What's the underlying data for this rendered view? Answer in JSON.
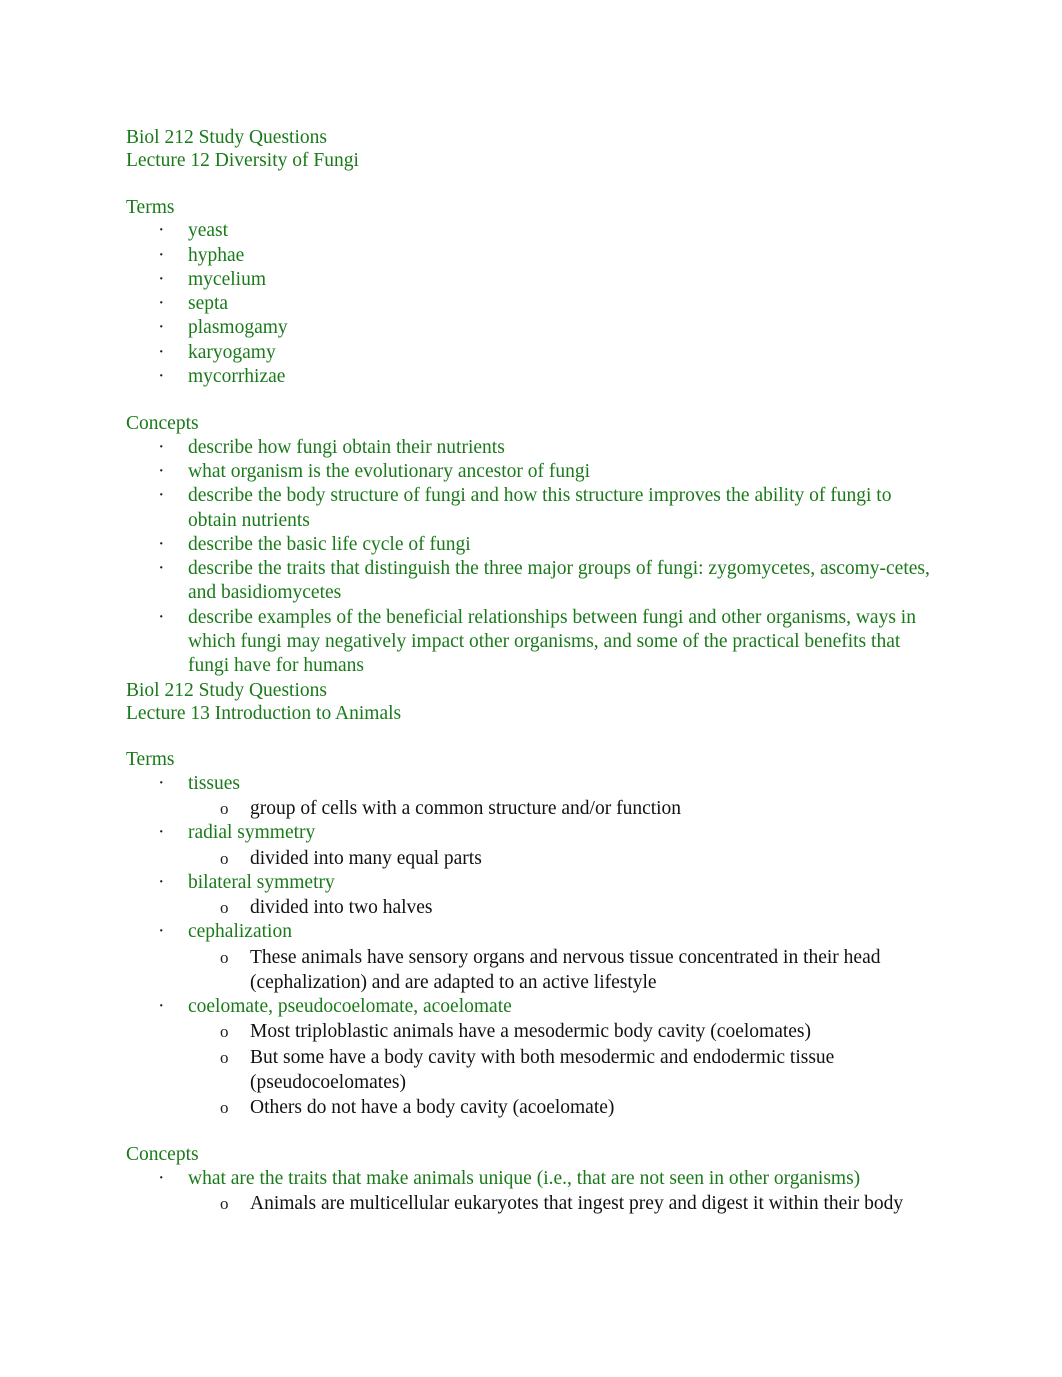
{
  "document": {
    "page_color": "#ffffff",
    "heading_color": "#1a7a1a",
    "body_color": "#111111",
    "bullet_marker_level1": "·",
    "bullet_marker_level2": "o"
  },
  "sections": [
    {
      "title_line1": "Biol 212 Study Questions",
      "title_line2": "Lecture 12 Diversity of Fungi",
      "terms_heading": "Terms",
      "terms": [
        {
          "text": "yeast"
        },
        {
          "text": "hyphae"
        },
        {
          "text": "mycelium"
        },
        {
          "text": "septa"
        },
        {
          "text": "plasmogamy"
        },
        {
          "text": "karyogamy"
        },
        {
          "text": "mycorrhizae"
        }
      ],
      "concepts_heading": "Concepts",
      "concepts": [
        {
          "text": "describe how fungi obtain their nutrients"
        },
        {
          "text": "what organism is the evolutionary ancestor of fungi"
        },
        {
          "text": "describe the body structure of fungi and how this structure improves the ability of fungi to obtain nutrients"
        },
        {
          "text": "describe the basic life cycle of fungi"
        },
        {
          "text": "describe the traits that distinguish the three major groups of fungi: zygomycetes, ascomy-cetes, and basidiomycetes"
        },
        {
          "text": "describe examples of the beneficial relationships between fungi and other organisms, ways in which fungi may negatively impact other organisms, and some of the practical benefits that fungi have for humans"
        }
      ]
    },
    {
      "title_line1": "Biol 212 Study Questions",
      "title_line2": "Lecture 13 Introduction to Animals",
      "terms_heading": "Terms",
      "terms": [
        {
          "text": "tissues",
          "sub": [
            "group of cells with a common structure and/or function"
          ]
        },
        {
          "text": "radial symmetry",
          "sub": [
            "divided into many equal parts"
          ]
        },
        {
          "text": "bilateral symmetry",
          "sub": [
            "divided into two halves"
          ]
        },
        {
          "text": "cephalization",
          "sub": [
            "These animals have sensory organs and nervous tissue concentrated in their head (cephalization) and are adapted to an active lifestyle"
          ]
        },
        {
          "text": "coelomate, pseudocoelomate, acoelomate",
          "sub": [
            "Most triploblastic animals have a mesodermic body cavity (coelomates)",
            "But some have a body cavity with both mesodermic and endodermic tissue (pseudocoelomates)",
            "Others do not have a body cavity (acoelomate)"
          ]
        }
      ],
      "concepts_heading": "Concepts",
      "concepts": [
        {
          "text": "what are the traits that make animals unique (i.e., that are not seen in other organisms)",
          "sub": [
            "Animals are multicellular eukaryotes that ingest prey and digest it within their body"
          ]
        }
      ]
    }
  ]
}
